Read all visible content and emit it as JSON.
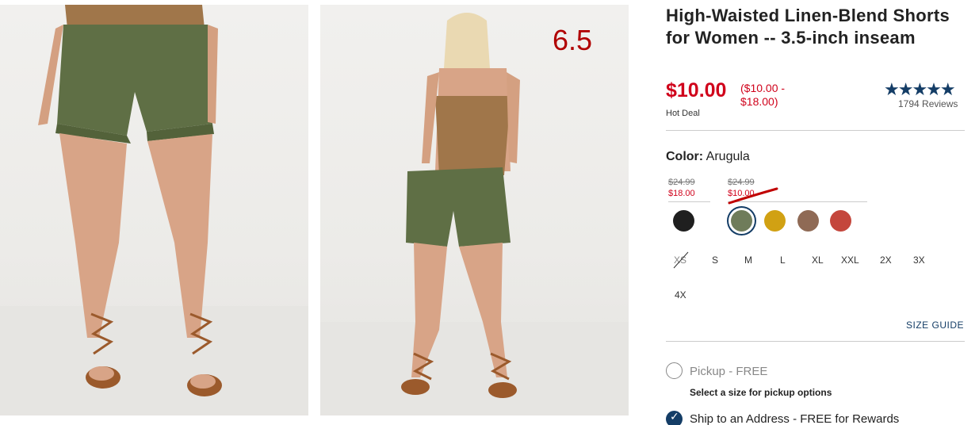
{
  "annotation": "6.5",
  "product": {
    "title": "High-Waisted Linen-Blend Shorts for Women -- 3.5-inch inseam",
    "price": "$10.00",
    "price_range": "($10.00 - $18.00)",
    "deal_label": "Hot Deal",
    "rating_stars": "★★★★★",
    "reviews": "1794 Reviews"
  },
  "color": {
    "label": "Color:",
    "value": "Arugula",
    "price_groups": [
      {
        "was": "$24.99",
        "now": "$18.00"
      },
      {
        "was": "$24.99",
        "now": "$10.00"
      }
    ],
    "swatches": [
      {
        "name": "black",
        "hex": "#1f1f1f"
      },
      {
        "name": "arugula",
        "hex": "#6f7c5a"
      },
      {
        "name": "mustard",
        "hex": "#d1a113"
      },
      {
        "name": "brown",
        "hex": "#8f6a55"
      },
      {
        "name": "red",
        "hex": "#c4463c"
      }
    ],
    "selected": "arugula"
  },
  "sizes": [
    "XS",
    "S",
    "M",
    "L",
    "XL",
    "XXL",
    "2X",
    "3X",
    "4X"
  ],
  "size_guide": "SIZE GUIDE",
  "fulfillment": {
    "pickup_label": "Pickup - FREE",
    "pickup_note": "Select a size for pickup options",
    "ship_label": "Ship to an Address - FREE for Rewards"
  },
  "colors": {
    "sale_red": "#d0021b",
    "navy": "#143d66"
  }
}
